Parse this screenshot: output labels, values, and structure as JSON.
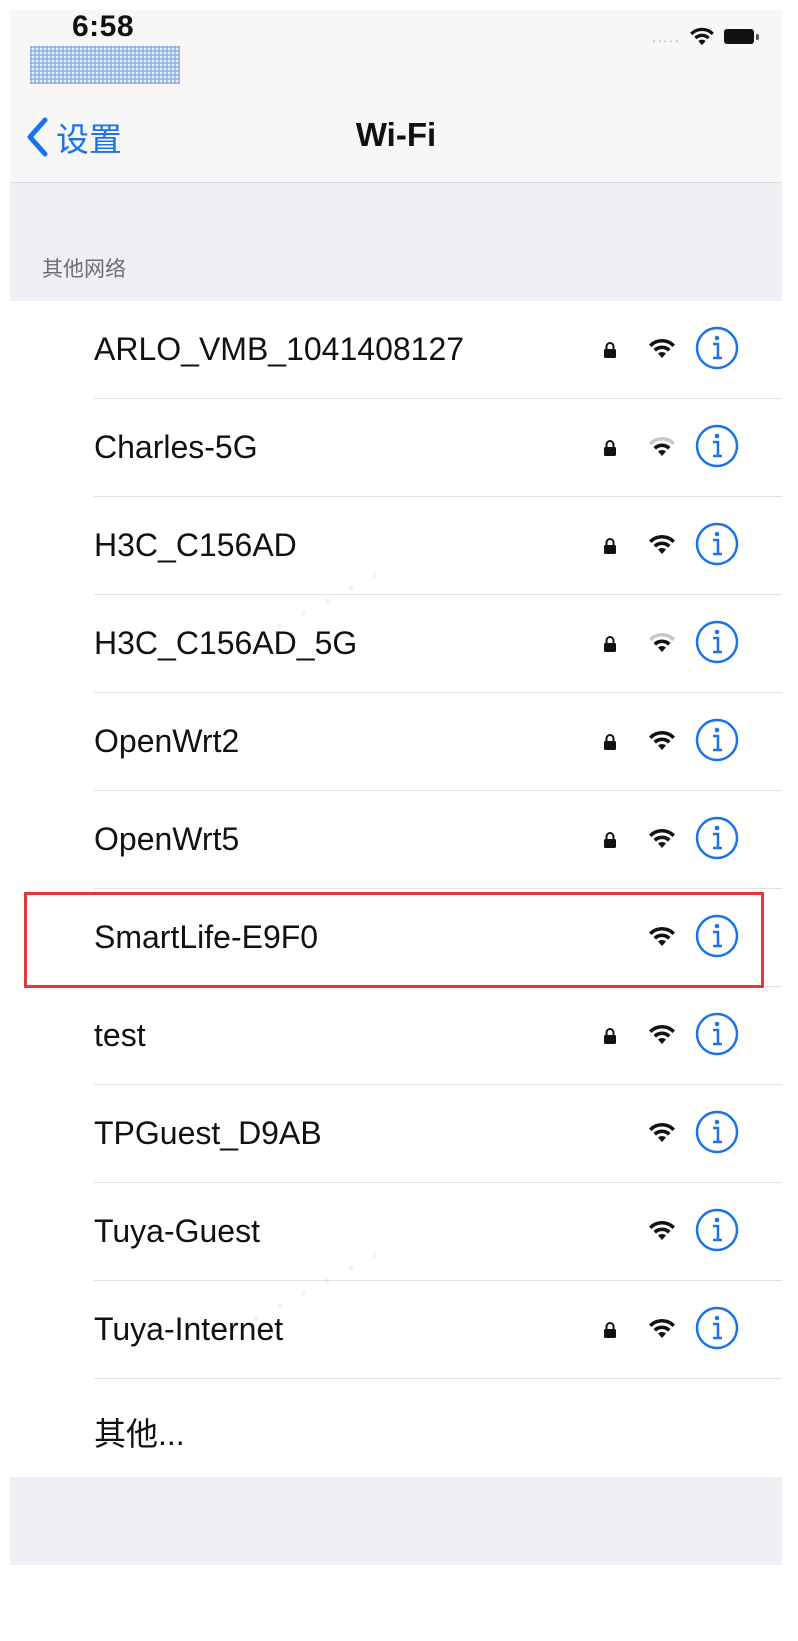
{
  "status_bar": {
    "time": "6:58",
    "wifi_icon": "wifi-icon",
    "battery_icon": "battery-icon"
  },
  "nav": {
    "back_label": "设置",
    "back_icon": "chevron-left-icon",
    "title": "Wi-Fi"
  },
  "section": {
    "header": "其他网络"
  },
  "networks": [
    {
      "name": "ARLO_VMB_1041408127",
      "locked": true,
      "signal": 3
    },
    {
      "name": "Charles-5G",
      "locked": true,
      "signal": 2
    },
    {
      "name": "H3C_C156AD",
      "locked": true,
      "signal": 3
    },
    {
      "name": "H3C_C156AD_5G",
      "locked": true,
      "signal": 2
    },
    {
      "name": "OpenWrt2",
      "locked": true,
      "signal": 3
    },
    {
      "name": "OpenWrt5",
      "locked": true,
      "signal": 3
    },
    {
      "name": "SmartLife-E9F0",
      "locked": false,
      "signal": 3,
      "highlighted": true
    },
    {
      "name": "test",
      "locked": true,
      "signal": 3
    },
    {
      "name": "TPGuest_D9AB",
      "locked": false,
      "signal": 3
    },
    {
      "name": "Tuya-Guest",
      "locked": false,
      "signal": 3
    },
    {
      "name": "Tuya-Internet",
      "locked": true,
      "signal": 3
    }
  ],
  "other_label": "其他...",
  "colors": {
    "accent": "#1a73e8",
    "highlight": "#e03a3a",
    "background": "#efeff4"
  },
  "icons": {
    "lock": "lock-icon",
    "wifi": "wifi-icon",
    "info": "info-icon"
  }
}
